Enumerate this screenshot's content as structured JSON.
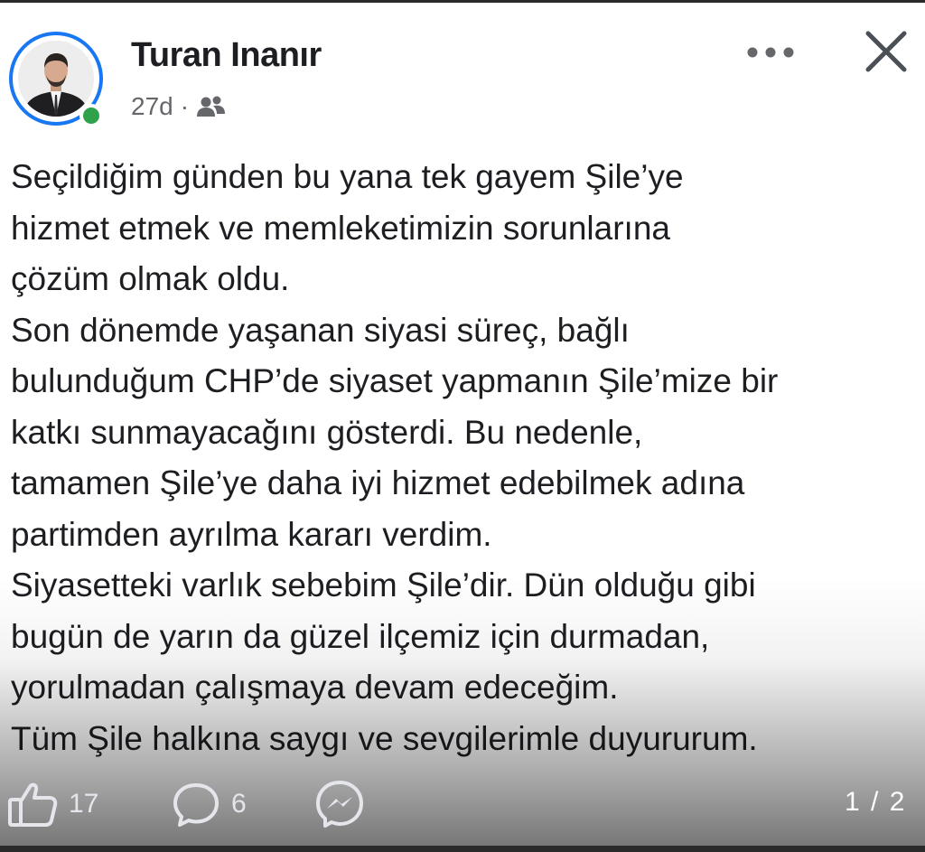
{
  "post": {
    "author_name": "Turan Inanır",
    "age": "27d",
    "separator": "·",
    "audience_icon": "friends-icon",
    "text_lines": [
      "Seçildiğim günden bu yana tek gayem Şile’ye",
      "hizmet etmek ve memleketimizin sorunlarına",
      "çözüm olmak oldu.",
      "Son dönemde yaşanan siyasi süreç, bağlı",
      "bulunduğum CHP’de siyaset yapmanın Şile’mize bir",
      "katkı sunmayacağını gösterdi. Bu nedenle,",
      "tamamen Şile’ye daha iyi hizmet edebilmek adına",
      "partimden ayrılma kararı verdim.",
      "Siyasetteki varlık sebebim Şile’dir. Dün olduğu gibi",
      "bugün de yarın da güzel ilçemiz için durmadan,",
      "yorulmadan çalışmaya devam edeceğim.",
      "Tüm Şile halkına saygı ve sevgilerimle duyururum."
    ]
  },
  "actions": {
    "likes": "17",
    "comments": "6",
    "like_icon": "thumbs-up-icon",
    "comment_icon": "comment-icon",
    "messenger_icon": "messenger-icon"
  },
  "pager": {
    "label": "1 / 2"
  },
  "colors": {
    "accent": "#1877f2",
    "online": "#31a24c",
    "text": "#1c1e21",
    "meta": "#65676b"
  }
}
